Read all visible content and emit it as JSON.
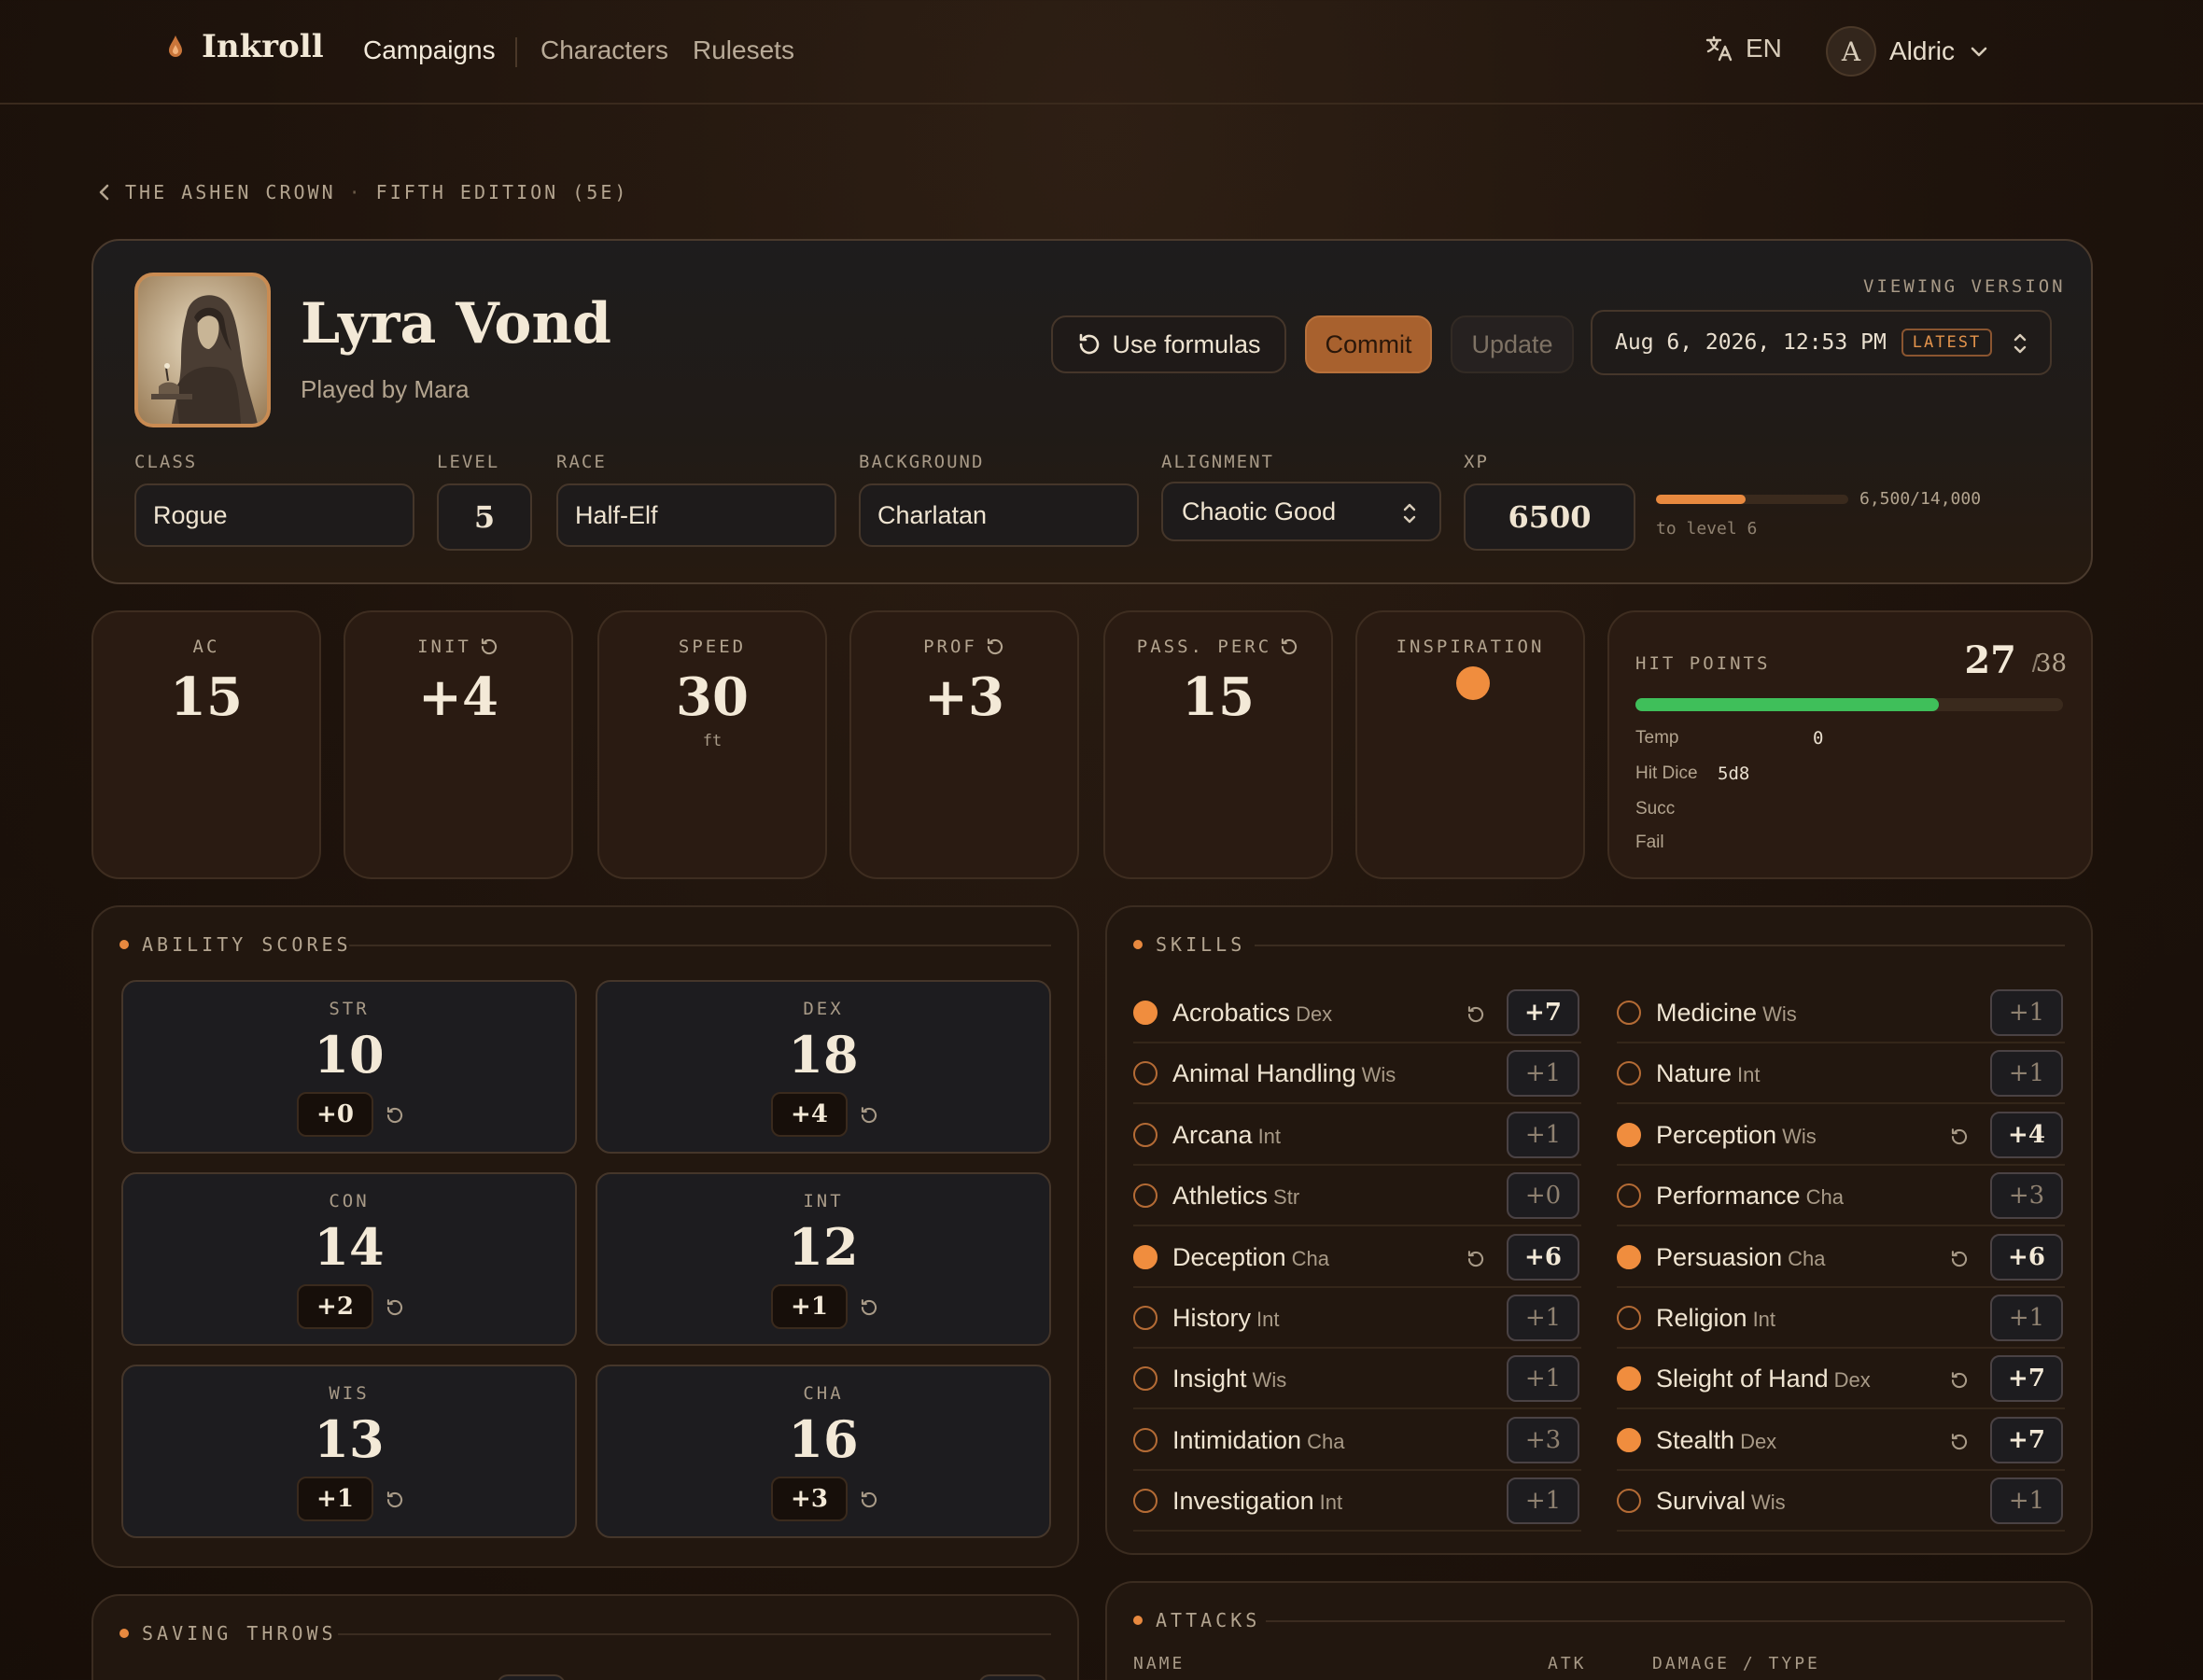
{
  "nav": {
    "brand": "Inkroll",
    "links": [
      "Campaigns",
      "Characters",
      "Rulesets"
    ],
    "language": "EN",
    "user_initial": "A",
    "user_name": "Aldric"
  },
  "breadcrumb": {
    "campaign": "THE ASHEN CROWN",
    "ruleset": "FIFTH EDITION (5E)"
  },
  "character": {
    "name": "Lyra Vond",
    "played_by": "Played by Mara",
    "actions": {
      "use_formulas": "Use formulas",
      "commit": "Commit",
      "update": "Update"
    },
    "version": {
      "label": "VIEWING VERSION",
      "value": "Aug 6, 2026, 12:53 PM",
      "badge": "LATEST"
    },
    "fields": {
      "class_label": "CLASS",
      "class": "Rogue",
      "level_label": "LEVEL",
      "level": "5",
      "race_label": "RACE",
      "race": "Half-Elf",
      "background_label": "BACKGROUND",
      "background": "Charlatan",
      "alignment_label": "ALIGNMENT",
      "alignment": "Chaotic Good",
      "xp_label": "XP",
      "xp": "6500"
    },
    "xp_progress": {
      "text": "6,500/14,000",
      "sub": "to level 6",
      "fraction": 0.464
    }
  },
  "stats": {
    "ac": {
      "label": "AC",
      "value": "15"
    },
    "init": {
      "label": "INIT",
      "value": "+4"
    },
    "speed": {
      "label": "SPEED",
      "value": "30",
      "unit": "ft"
    },
    "prof": {
      "label": "PROF",
      "value": "+3"
    },
    "pass_perc": {
      "label": "PASS. PERC",
      "value": "15"
    },
    "inspiration": {
      "label": "INSPIRATION",
      "active": true
    }
  },
  "hit_points": {
    "label": "HIT POINTS",
    "current": "27",
    "max": "38",
    "fraction": 0.71,
    "temp_label": "Temp",
    "temp": "0",
    "hit_dice_label": "Hit Dice",
    "hit_dice": "5d8",
    "succ_label": "Succ",
    "fail_label": "Fail"
  },
  "abilities": {
    "title": "ABILITY SCORES",
    "items": [
      {
        "label": "STR",
        "score": "10",
        "mod": "+0"
      },
      {
        "label": "DEX",
        "score": "18",
        "mod": "+4"
      },
      {
        "label": "CON",
        "score": "14",
        "mod": "+2"
      },
      {
        "label": "INT",
        "score": "12",
        "mod": "+1"
      },
      {
        "label": "WIS",
        "score": "13",
        "mod": "+1"
      },
      {
        "label": "CHA",
        "score": "16",
        "mod": "+3"
      }
    ]
  },
  "skills": {
    "title": "SKILLS",
    "items": [
      {
        "name": "Acrobatics",
        "ability": "Dex",
        "mod": "+7",
        "proficient": true
      },
      {
        "name": "Animal Handling",
        "ability": "Wis",
        "mod": "+1",
        "proficient": false
      },
      {
        "name": "Arcana",
        "ability": "Int",
        "mod": "+1",
        "proficient": false
      },
      {
        "name": "Athletics",
        "ability": "Str",
        "mod": "+0",
        "proficient": false
      },
      {
        "name": "Deception",
        "ability": "Cha",
        "mod": "+6",
        "proficient": true
      },
      {
        "name": "History",
        "ability": "Int",
        "mod": "+1",
        "proficient": false
      },
      {
        "name": "Insight",
        "ability": "Wis",
        "mod": "+1",
        "proficient": false
      },
      {
        "name": "Intimidation",
        "ability": "Cha",
        "mod": "+3",
        "proficient": false
      },
      {
        "name": "Investigation",
        "ability": "Int",
        "mod": "+1",
        "proficient": false
      },
      {
        "name": "Medicine",
        "ability": "Wis",
        "mod": "+1",
        "proficient": false
      },
      {
        "name": "Nature",
        "ability": "Int",
        "mod": "+1",
        "proficient": false
      },
      {
        "name": "Perception",
        "ability": "Wis",
        "mod": "+4",
        "proficient": true
      },
      {
        "name": "Performance",
        "ability": "Cha",
        "mod": "+3",
        "proficient": false
      },
      {
        "name": "Persuasion",
        "ability": "Cha",
        "mod": "+6",
        "proficient": true
      },
      {
        "name": "Religion",
        "ability": "Int",
        "mod": "+1",
        "proficient": false
      },
      {
        "name": "Sleight of Hand",
        "ability": "Dex",
        "mod": "+7",
        "proficient": true
      },
      {
        "name": "Stealth",
        "ability": "Dex",
        "mod": "+7",
        "proficient": true
      },
      {
        "name": "Survival",
        "ability": "Wis",
        "mod": "+1",
        "proficient": false
      }
    ]
  },
  "saving_throws": {
    "title": "SAVING THROWS"
  },
  "attacks": {
    "title": "ATTACKS",
    "col_name": "NAME",
    "col_atk": "ATK",
    "col_damage": "DAMAGE / TYPE"
  },
  "colors": {
    "accent": "#e8893f",
    "commit": "#a8612e",
    "hp_bar": "#3fbf5a",
    "background": "#1e130c"
  }
}
